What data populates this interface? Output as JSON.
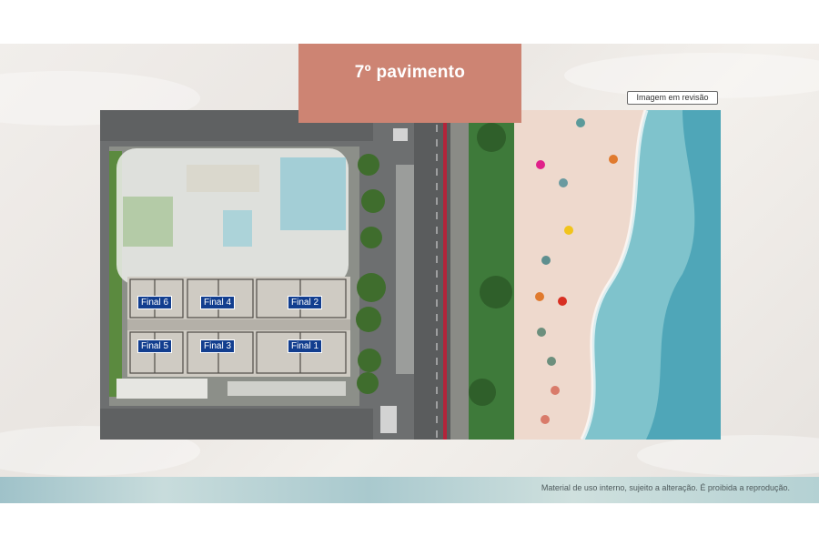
{
  "title": "7º pavimento",
  "review_badge": "Imagem em revisão",
  "footer_note": "Material de uso interno, sujeito a alteração.  É  proibida a reprodução.",
  "units": [
    {
      "id": "final-6",
      "label": "Final 6"
    },
    {
      "id": "final-4",
      "label": "Final 4"
    },
    {
      "id": "final-2",
      "label": "Final 2"
    },
    {
      "id": "final-5",
      "label": "Final 5"
    },
    {
      "id": "final-3",
      "label": "Final 3"
    },
    {
      "id": "final-1",
      "label": "Final 1"
    }
  ],
  "colors": {
    "title_bg": "#cd8473",
    "unit_label_bg": "#123e8f",
    "bike_lane": "#b3243a",
    "sea": "#7fc3cc"
  }
}
